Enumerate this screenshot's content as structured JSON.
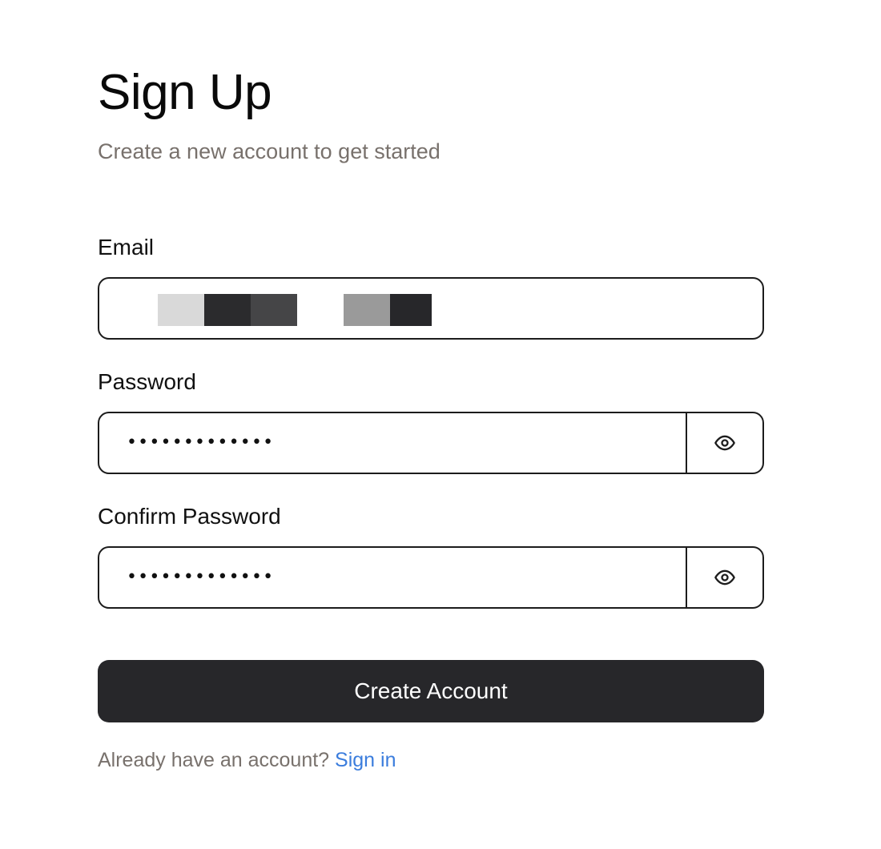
{
  "header": {
    "title": "Sign Up",
    "subtitle": "Create a new account to get started"
  },
  "form": {
    "email": {
      "label": "Email",
      "value_redacted": true,
      "redaction_colors": [
        "#d9d9d9",
        "#2b2b2d",
        "#454547",
        "#ffffff",
        "#9a9a9a",
        "#27272a"
      ]
    },
    "password": {
      "label": "Password",
      "masked_value": "•••••••••••••",
      "toggle_icon": "eye-icon"
    },
    "confirm_password": {
      "label": "Confirm Password",
      "masked_value": "•••••••••••••",
      "toggle_icon": "eye-icon"
    },
    "submit_label": "Create Account"
  },
  "footer": {
    "prompt": "Already have an account?",
    "link_label": "Sign in"
  },
  "colors": {
    "primary_button": "#27272a",
    "muted_text": "#78716c",
    "link": "#3b7ddd",
    "border": "#1c1c1c"
  }
}
